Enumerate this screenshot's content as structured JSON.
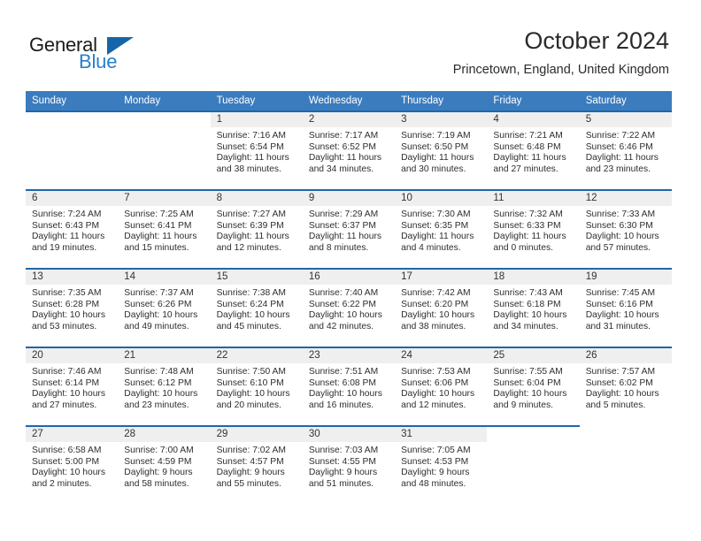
{
  "brand": {
    "name_part1": "General",
    "name_part2": "Blue"
  },
  "header": {
    "month_title": "October 2024",
    "location": "Princetown, England, United Kingdom"
  },
  "colors": {
    "header_blue": "#3b7cbf",
    "rule_blue": "#1f66ab",
    "daynum_band": "#efefef",
    "brand_blue": "#2a7fc9",
    "logo_triangle": "#1565a8"
  },
  "weekday_headers": [
    "Sunday",
    "Monday",
    "Tuesday",
    "Wednesday",
    "Thursday",
    "Friday",
    "Saturday"
  ],
  "weeks": [
    {
      "rule_partial": false,
      "days": [
        {
          "num": "",
          "blank": true,
          "lines": []
        },
        {
          "num": "",
          "blank": true,
          "lines": []
        },
        {
          "num": "1",
          "blank": false,
          "lines": [
            "Sunrise: 7:16 AM",
            "Sunset: 6:54 PM",
            "Daylight: 11 hours",
            "and 38 minutes."
          ]
        },
        {
          "num": "2",
          "blank": false,
          "lines": [
            "Sunrise: 7:17 AM",
            "Sunset: 6:52 PM",
            "Daylight: 11 hours",
            "and 34 minutes."
          ]
        },
        {
          "num": "3",
          "blank": false,
          "lines": [
            "Sunrise: 7:19 AM",
            "Sunset: 6:50 PM",
            "Daylight: 11 hours",
            "and 30 minutes."
          ]
        },
        {
          "num": "4",
          "blank": false,
          "lines": [
            "Sunrise: 7:21 AM",
            "Sunset: 6:48 PM",
            "Daylight: 11 hours",
            "and 27 minutes."
          ]
        },
        {
          "num": "5",
          "blank": false,
          "lines": [
            "Sunrise: 7:22 AM",
            "Sunset: 6:46 PM",
            "Daylight: 11 hours",
            "and 23 minutes."
          ]
        }
      ]
    },
    {
      "rule_partial": false,
      "days": [
        {
          "num": "6",
          "blank": false,
          "lines": [
            "Sunrise: 7:24 AM",
            "Sunset: 6:43 PM",
            "Daylight: 11 hours",
            "and 19 minutes."
          ]
        },
        {
          "num": "7",
          "blank": false,
          "lines": [
            "Sunrise: 7:25 AM",
            "Sunset: 6:41 PM",
            "Daylight: 11 hours",
            "and 15 minutes."
          ]
        },
        {
          "num": "8",
          "blank": false,
          "lines": [
            "Sunrise: 7:27 AM",
            "Sunset: 6:39 PM",
            "Daylight: 11 hours",
            "and 12 minutes."
          ]
        },
        {
          "num": "9",
          "blank": false,
          "lines": [
            "Sunrise: 7:29 AM",
            "Sunset: 6:37 PM",
            "Daylight: 11 hours",
            "and 8 minutes."
          ]
        },
        {
          "num": "10",
          "blank": false,
          "lines": [
            "Sunrise: 7:30 AM",
            "Sunset: 6:35 PM",
            "Daylight: 11 hours",
            "and 4 minutes."
          ]
        },
        {
          "num": "11",
          "blank": false,
          "lines": [
            "Sunrise: 7:32 AM",
            "Sunset: 6:33 PM",
            "Daylight: 11 hours",
            "and 0 minutes."
          ]
        },
        {
          "num": "12",
          "blank": false,
          "lines": [
            "Sunrise: 7:33 AM",
            "Sunset: 6:30 PM",
            "Daylight: 10 hours",
            "and 57 minutes."
          ]
        }
      ]
    },
    {
      "rule_partial": false,
      "days": [
        {
          "num": "13",
          "blank": false,
          "lines": [
            "Sunrise: 7:35 AM",
            "Sunset: 6:28 PM",
            "Daylight: 10 hours",
            "and 53 minutes."
          ]
        },
        {
          "num": "14",
          "blank": false,
          "lines": [
            "Sunrise: 7:37 AM",
            "Sunset: 6:26 PM",
            "Daylight: 10 hours",
            "and 49 minutes."
          ]
        },
        {
          "num": "15",
          "blank": false,
          "lines": [
            "Sunrise: 7:38 AM",
            "Sunset: 6:24 PM",
            "Daylight: 10 hours",
            "and 45 minutes."
          ]
        },
        {
          "num": "16",
          "blank": false,
          "lines": [
            "Sunrise: 7:40 AM",
            "Sunset: 6:22 PM",
            "Daylight: 10 hours",
            "and 42 minutes."
          ]
        },
        {
          "num": "17",
          "blank": false,
          "lines": [
            "Sunrise: 7:42 AM",
            "Sunset: 6:20 PM",
            "Daylight: 10 hours",
            "and 38 minutes."
          ]
        },
        {
          "num": "18",
          "blank": false,
          "lines": [
            "Sunrise: 7:43 AM",
            "Sunset: 6:18 PM",
            "Daylight: 10 hours",
            "and 34 minutes."
          ]
        },
        {
          "num": "19",
          "blank": false,
          "lines": [
            "Sunrise: 7:45 AM",
            "Sunset: 6:16 PM",
            "Daylight: 10 hours",
            "and 31 minutes."
          ]
        }
      ]
    },
    {
      "rule_partial": false,
      "days": [
        {
          "num": "20",
          "blank": false,
          "lines": [
            "Sunrise: 7:46 AM",
            "Sunset: 6:14 PM",
            "Daylight: 10 hours",
            "and 27 minutes."
          ]
        },
        {
          "num": "21",
          "blank": false,
          "lines": [
            "Sunrise: 7:48 AM",
            "Sunset: 6:12 PM",
            "Daylight: 10 hours",
            "and 23 minutes."
          ]
        },
        {
          "num": "22",
          "blank": false,
          "lines": [
            "Sunrise: 7:50 AM",
            "Sunset: 6:10 PM",
            "Daylight: 10 hours",
            "and 20 minutes."
          ]
        },
        {
          "num": "23",
          "blank": false,
          "lines": [
            "Sunrise: 7:51 AM",
            "Sunset: 6:08 PM",
            "Daylight: 10 hours",
            "and 16 minutes."
          ]
        },
        {
          "num": "24",
          "blank": false,
          "lines": [
            "Sunrise: 7:53 AM",
            "Sunset: 6:06 PM",
            "Daylight: 10 hours",
            "and 12 minutes."
          ]
        },
        {
          "num": "25",
          "blank": false,
          "lines": [
            "Sunrise: 7:55 AM",
            "Sunset: 6:04 PM",
            "Daylight: 10 hours",
            "and 9 minutes."
          ]
        },
        {
          "num": "26",
          "blank": false,
          "lines": [
            "Sunrise: 7:57 AM",
            "Sunset: 6:02 PM",
            "Daylight: 10 hours",
            "and 5 minutes."
          ]
        }
      ]
    },
    {
      "rule_partial": true,
      "days": [
        {
          "num": "27",
          "blank": false,
          "lines": [
            "Sunrise: 6:58 AM",
            "Sunset: 5:00 PM",
            "Daylight: 10 hours",
            "and 2 minutes."
          ]
        },
        {
          "num": "28",
          "blank": false,
          "lines": [
            "Sunrise: 7:00 AM",
            "Sunset: 4:59 PM",
            "Daylight: 9 hours",
            "and 58 minutes."
          ]
        },
        {
          "num": "29",
          "blank": false,
          "lines": [
            "Sunrise: 7:02 AM",
            "Sunset: 4:57 PM",
            "Daylight: 9 hours",
            "and 55 minutes."
          ]
        },
        {
          "num": "30",
          "blank": false,
          "lines": [
            "Sunrise: 7:03 AM",
            "Sunset: 4:55 PM",
            "Daylight: 9 hours",
            "and 51 minutes."
          ]
        },
        {
          "num": "31",
          "blank": false,
          "lines": [
            "Sunrise: 7:05 AM",
            "Sunset: 4:53 PM",
            "Daylight: 9 hours",
            "and 48 minutes."
          ]
        },
        {
          "num": "",
          "blank": true,
          "lines": []
        },
        {
          "num": "",
          "blank": true,
          "lines": []
        }
      ]
    }
  ]
}
